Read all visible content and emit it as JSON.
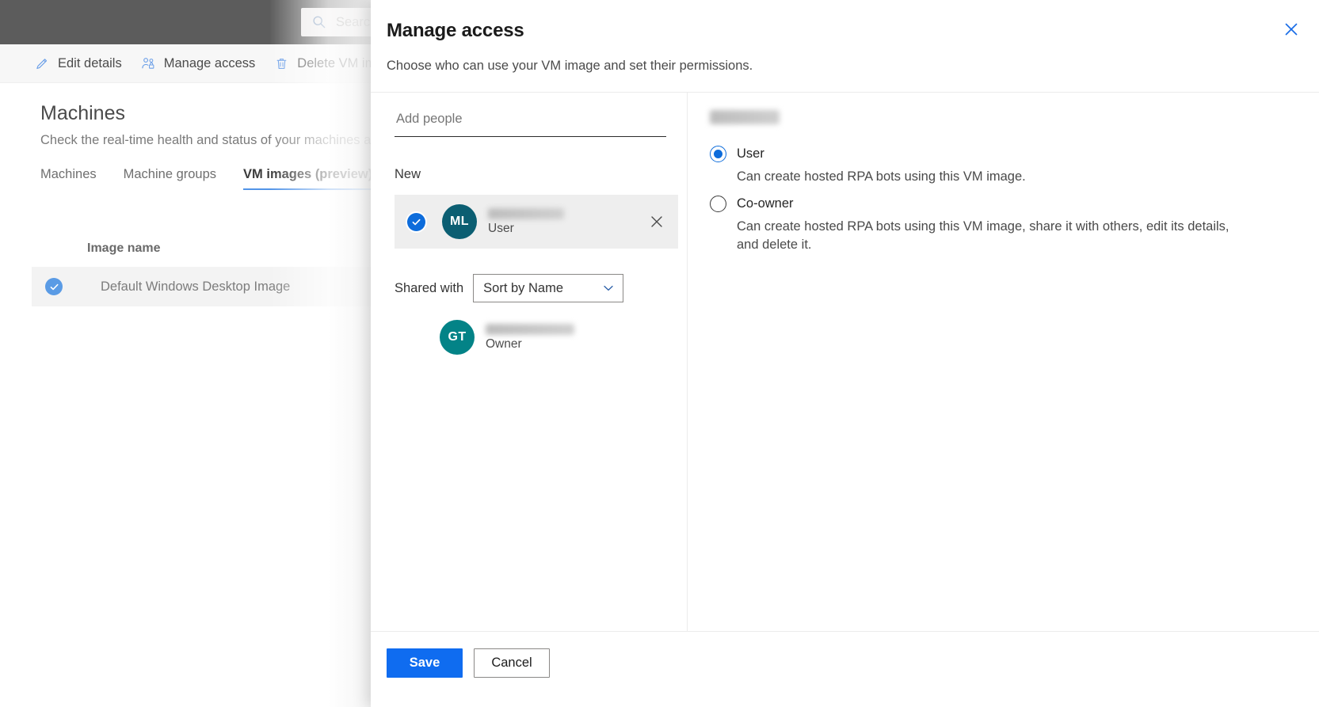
{
  "background": {
    "search": {
      "placeholder": "Search",
      "icon": "search-icon"
    },
    "commandbar": [
      {
        "label": "Edit details",
        "icon": "pencil-icon"
      },
      {
        "label": "Manage access",
        "icon": "people-lock-icon"
      },
      {
        "label": "Delete VM image",
        "icon": "trash-icon"
      }
    ],
    "page_title": "Machines",
    "page_subtitle": "Check the real-time health and status of your machines and",
    "tabs": [
      {
        "label": "Machines",
        "active": false
      },
      {
        "label": "Machine groups",
        "active": false
      },
      {
        "label": "VM images (preview)",
        "active": true
      }
    ],
    "grid": {
      "columns": [
        "Image name"
      ],
      "rows": [
        {
          "name": "Default Windows Desktop Image",
          "selected": true
        }
      ]
    },
    "accent": "#5294e8",
    "topbar_color": "#5c5c5c"
  },
  "dialog": {
    "title": "Manage access",
    "subtitle": "Choose who can use your VM image and set their permissions.",
    "close_icon": "close-icon",
    "close_color": "#1a6ce7",
    "left": {
      "add_people_placeholder": "Add people",
      "add_people_value": "",
      "new_section_label": "New",
      "new_people": [
        {
          "initials": "ML",
          "name": "",
          "name_redacted": true,
          "role": "User",
          "selected": true,
          "avatar_color": "#0b5e72",
          "remove_icon": "close-icon"
        }
      ],
      "shared_with_label": "Shared with",
      "sort_selected": "Sort by Name",
      "sort_options": [
        "Sort by Name"
      ],
      "sort_chevron_icon": "chevron-down-icon",
      "shared_people": [
        {
          "initials": "GT",
          "name": "",
          "name_redacted": true,
          "role": "Owner",
          "avatar_color": "#038387"
        }
      ]
    },
    "right": {
      "person_name": "",
      "person_name_redacted": true,
      "permissions": [
        {
          "label": "User",
          "description": "Can create hosted RPA bots using this VM image.",
          "selected": true
        },
        {
          "label": "Co-owner",
          "description": "Can create hosted RPA bots using this VM image, share it with others, edit its details, and delete it.",
          "selected": false
        }
      ]
    },
    "footer": {
      "save_label": "Save",
      "cancel_label": "Cancel",
      "primary_color": "#0f6cf0"
    }
  }
}
